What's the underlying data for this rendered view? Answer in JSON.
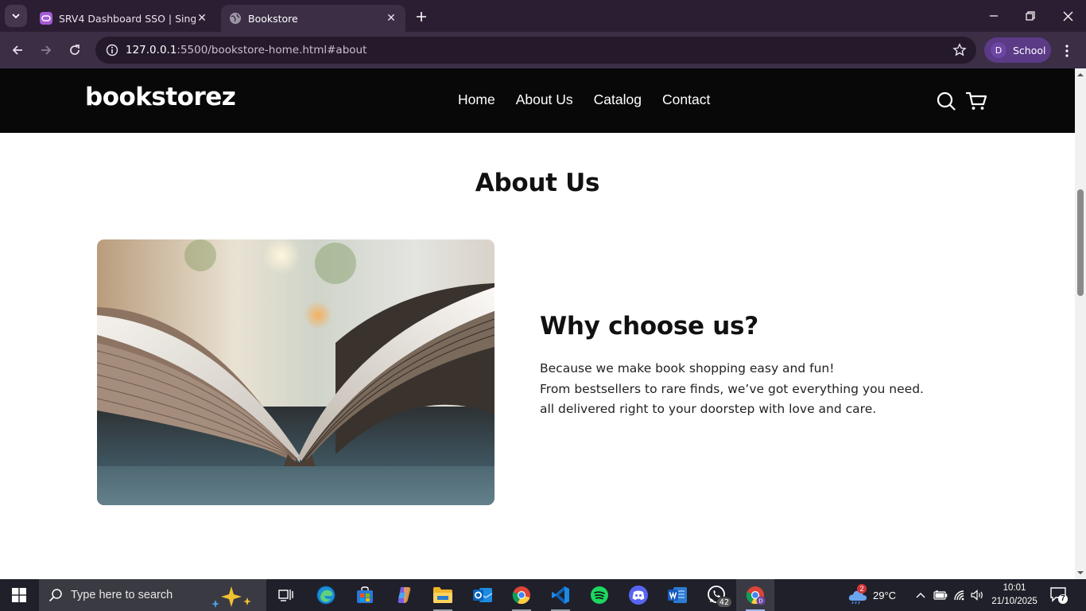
{
  "browser": {
    "tabs": [
      {
        "title": "SRV4 Dashboard SSO | Single Si",
        "active": false
      },
      {
        "title": "Bookstore",
        "active": true
      }
    ],
    "url_host": "127.0.0.1",
    "url_rest": ":5500/bookstore-home.html#about",
    "profile_initial": "D",
    "profile_label": "School"
  },
  "site": {
    "logo": "bookstorez",
    "nav": [
      "Home",
      "About Us",
      "Catalog",
      "Contact"
    ],
    "about_title": "About Us",
    "why_title": "Why choose us?",
    "why_lines": [
      "Because we make book shopping easy and fun!",
      "From bestsellers to rare finds, we’ve got everything you need.",
      "all delivered right to your doorstep with love and care."
    ]
  },
  "taskbar": {
    "search_placeholder": "Type here to search",
    "weather": "29°C",
    "weather_badge": "2",
    "whatsapp_badge": "42",
    "time": "10:01",
    "date": "21/10/2025",
    "notification_count": "7"
  }
}
